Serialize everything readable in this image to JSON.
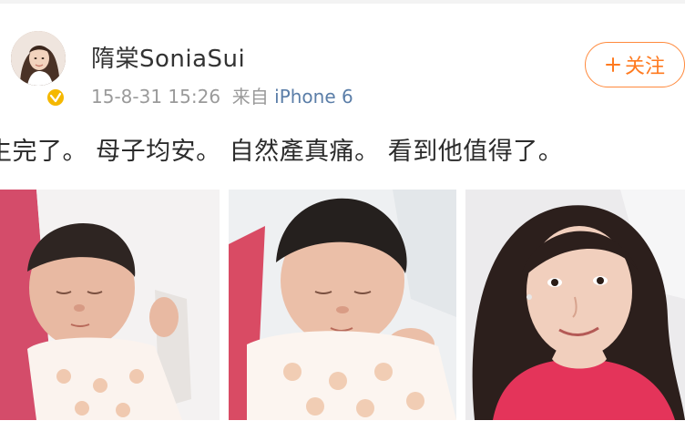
{
  "post": {
    "author": {
      "name": "隋棠SoniaSui",
      "avatar": "avatar-photo",
      "verified_icon": "verified-badge-icon"
    },
    "timestamp": "15-8-31 15:26",
    "source_prefix": "来自",
    "source": "iPhone 6",
    "follow_button": {
      "icon": "plus-icon",
      "label": "关注"
    },
    "text": "生完了。 母子均安。 自然產真痛。 看到他值得了。",
    "photos": [
      {
        "name": "newborn-photo-1"
      },
      {
        "name": "newborn-photo-2"
      },
      {
        "name": "mother-selfie-photo"
      }
    ]
  },
  "colors": {
    "accent": "#ff7a1f",
    "meta_text": "#9a9a9a",
    "source_link": "#5b7ea8",
    "verified": "#f5b800"
  }
}
